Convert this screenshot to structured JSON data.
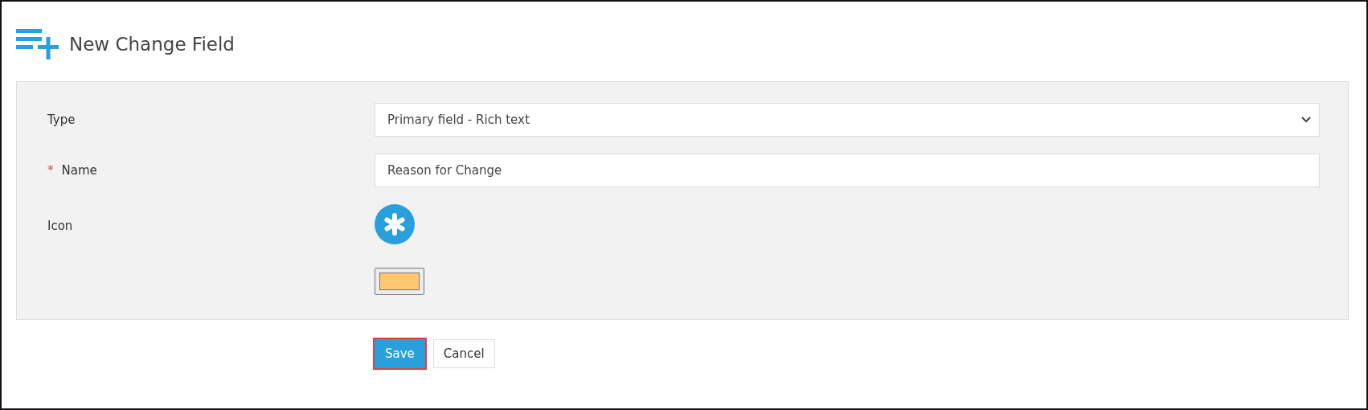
{
  "header": {
    "title": "New Change Field"
  },
  "form": {
    "fields": [
      {
        "kind": "select",
        "label": "Type",
        "required": false,
        "value": "Primary field - Rich text"
      },
      {
        "kind": "text",
        "label": "Name",
        "required": true,
        "required_mark": "*",
        "value": "Reason for Change"
      },
      {
        "kind": "icon",
        "label": "Icon",
        "required": false
      },
      {
        "kind": "color",
        "required": false,
        "color": "#ffc870"
      }
    ]
  },
  "buttons": [
    {
      "label": "Save",
      "kind": "primary",
      "focused": true
    },
    {
      "label": "Cancel",
      "kind": "secondary",
      "focused": false
    }
  ]
}
